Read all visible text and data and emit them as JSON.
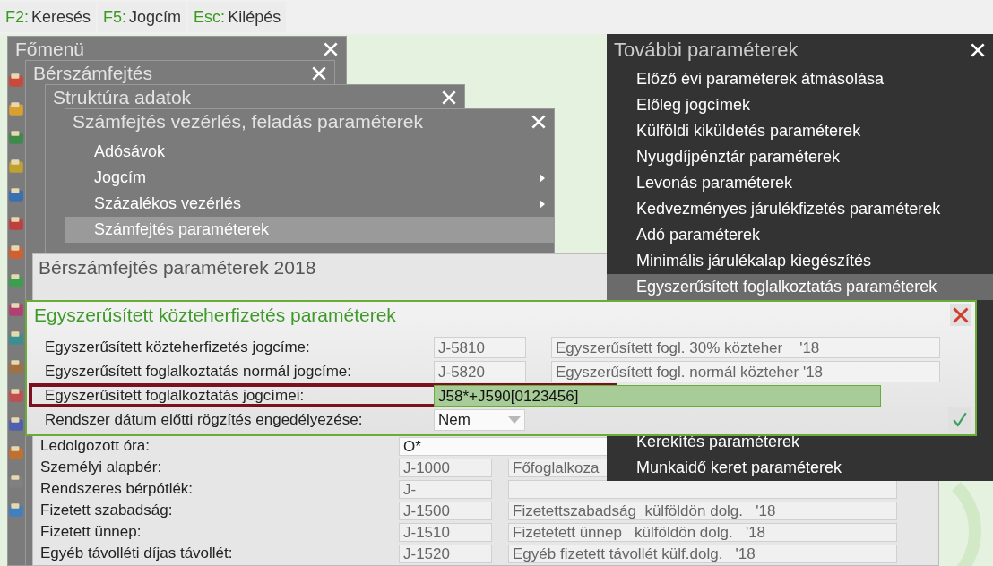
{
  "shortcut_bar": [
    {
      "key": "F2:",
      "label": "Keresés"
    },
    {
      "key": "F5:",
      "label": "Jogcím"
    },
    {
      "key": "Esc:",
      "label": "Kilépés"
    }
  ],
  "menus": [
    {
      "title": "Főmenü"
    },
    {
      "title": "Bérszámfejtés"
    },
    {
      "title": "Struktúra adatok"
    },
    {
      "title": "Számfejtés vezérlés, feladás paraméterek",
      "items": [
        {
          "label": "Adósávok",
          "has_submenu": false,
          "selected": false
        },
        {
          "label": "Jogcím",
          "has_submenu": true,
          "selected": false
        },
        {
          "label": "Százalékos vezérlés",
          "has_submenu": true,
          "selected": false
        },
        {
          "label": "Számfejtés paraméterek",
          "has_submenu": false,
          "selected": true
        }
      ]
    }
  ],
  "parameters_window": {
    "title": "Bérszámfejtés paraméterek 2018",
    "rows": [
      {
        "kind": "text",
        "label": "Ledolgozott óra:",
        "value": "O*"
      },
      {
        "kind": "code",
        "label": "Személyi alapbér:",
        "code": "J-1000",
        "description": "Főfoglalkoza"
      },
      {
        "kind": "code",
        "label": "Rendszeres bérpótlék:",
        "code": "J-"
      },
      {
        "kind": "code",
        "label": "Fizetett szabadság:",
        "code": "J-1500",
        "description": "Fizetettszabadság  külföldön dolg.   '18"
      },
      {
        "kind": "code",
        "label": "Fizetett ünnep:",
        "code": "J-1510",
        "description": "Fizetetett ünnep   külföldön dolg.   '18"
      },
      {
        "kind": "code",
        "label": "Egyéb távolléti díjas távollét:",
        "code": "J-1520",
        "description": "Egyéb fizetett távollét külf.dolg.   '18"
      }
    ]
  },
  "more_parameters_menu": {
    "title": "További paraméterek",
    "items": [
      {
        "label": "Előző évi paraméterek átmásolása",
        "selected": false
      },
      {
        "label": "Előleg jogcímek",
        "selected": false
      },
      {
        "label": "Külföldi kiküldetés paraméterek",
        "selected": false
      },
      {
        "label": "Nyugdíjpénztár paraméterek",
        "selected": false
      },
      {
        "label": "Levonás paraméterek",
        "selected": false
      },
      {
        "label": "Kedvezményes járulékfizetés paraméterek",
        "selected": false
      },
      {
        "label": "Adó paraméterek",
        "selected": false
      },
      {
        "label": "Minimális járulékalap kiegészítés",
        "selected": false
      },
      {
        "label": "Egyszerűsített foglalkoztatás paraméterek",
        "selected": true
      },
      {
        "label": "Kerekítés paraméterek",
        "selected": false
      },
      {
        "label": "Munkaidő keret paraméterek",
        "selected": false
      }
    ]
  },
  "dialog": {
    "title": "Egyszerűsített közteherfizetés paraméterek",
    "rows": [
      {
        "kind": "code",
        "label": "Egyszerűsített közteherfizetés jogcíme:",
        "code": "J-5810",
        "description": "Egyszerűsített fogl. 30% közteher    '18",
        "highlighted": false
      },
      {
        "kind": "code",
        "label": "Egyszerűsített foglalkoztatás normál jogcíme:",
        "code": "J-5820",
        "description": "Egyszerűsített fogl. normál közteher '18",
        "highlighted": false
      },
      {
        "kind": "text",
        "label": "Egyszerűsített foglalkoztatás jogcímei:",
        "value": "J58*+J590[0123456]",
        "highlighted": true
      },
      {
        "kind": "dropdown",
        "label": "Rendszer dátum előtti rögzítés engedélyezése:",
        "value": "Nem",
        "highlighted": false
      }
    ]
  }
}
